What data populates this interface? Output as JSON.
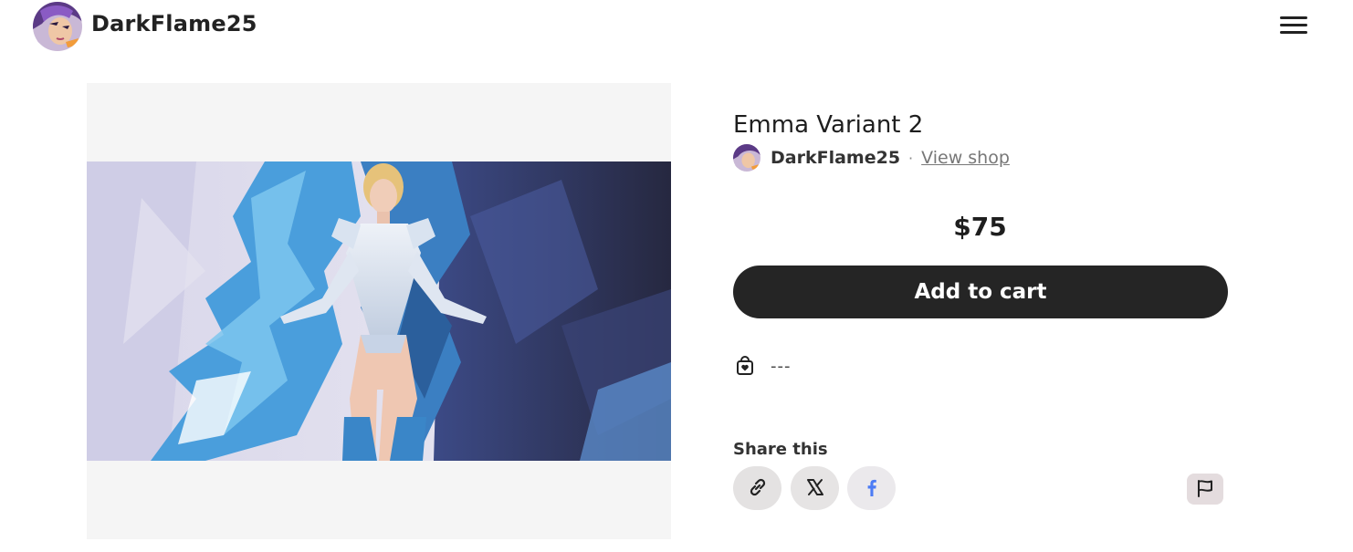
{
  "header": {
    "site_name": "DarkFlame25"
  },
  "product": {
    "title": "Emma Variant 2",
    "seller_name": "DarkFlame25",
    "separator": "·",
    "view_shop_label": "View shop",
    "price": "$75",
    "add_to_cart_label": "Add to cart",
    "info_value": "---"
  },
  "share": {
    "label": "Share this"
  },
  "icons": {
    "menu": "hamburger-menu-icon",
    "info": "shopping-bag-heart-icon",
    "share_link": "link-icon",
    "share_x": "x-logo-icon",
    "share_facebook": "facebook-icon",
    "report": "flag-icon"
  },
  "colors": {
    "button_dark": "#252525",
    "image_bg": "#f5f5f5",
    "facebook_blue": "#4c7cf5"
  }
}
